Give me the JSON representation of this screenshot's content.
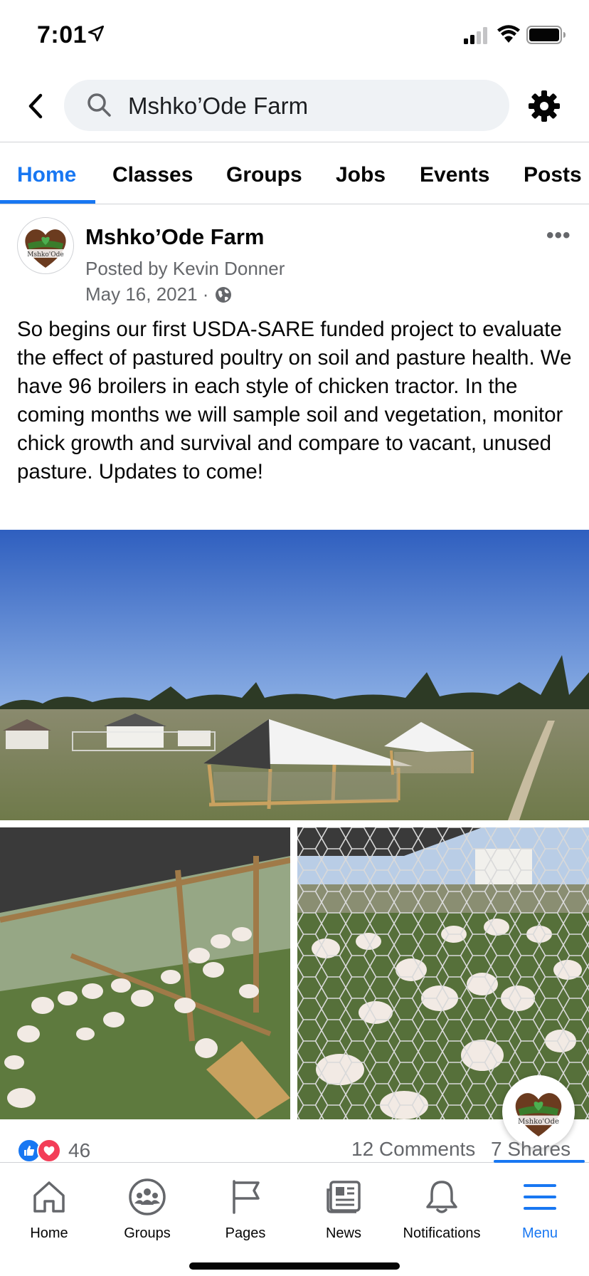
{
  "status_bar": {
    "time": "7:01"
  },
  "search": {
    "query": "Mshko’Ode Farm"
  },
  "tabs": [
    {
      "label": "Home",
      "active": true
    },
    {
      "label": "Classes",
      "active": false
    },
    {
      "label": "Groups",
      "active": false
    },
    {
      "label": "Jobs",
      "active": false
    },
    {
      "label": "Events",
      "active": false
    },
    {
      "label": "Posts",
      "active": false
    }
  ],
  "post": {
    "page_name": "Mshko’Ode Farm",
    "posted_by": "Posted by Kevin Donner",
    "date": "May 16, 2021 ·",
    "privacy_icon": "globe-icon",
    "text": "So begins our first USDA-SARE funded project to evaluate the effect of pastured poultry on soil and pasture health.  We have 96 broilers in each style of chicken tractor.  In the coming months we will sample soil and vegetation, monitor chick growth and survival and compare to vacant, unused pasture. Updates to come!",
    "logo_text": "Mshko'Ode",
    "reaction_count": "46",
    "comments": "12 Comments",
    "shares": "7 Shares"
  },
  "bottom_nav": [
    {
      "label": "Home",
      "icon": "home-icon",
      "active": false
    },
    {
      "label": "Groups",
      "icon": "groups-icon",
      "active": false
    },
    {
      "label": "Pages",
      "icon": "flag-icon",
      "active": false
    },
    {
      "label": "News",
      "icon": "news-icon",
      "active": false
    },
    {
      "label": "Notifications",
      "icon": "bell-icon",
      "active": false
    },
    {
      "label": "Menu",
      "icon": "menu-icon",
      "active": true
    }
  ],
  "colors": {
    "accent": "#1877f2",
    "secondary_text": "#65676b",
    "search_bg": "#eff2f5"
  }
}
